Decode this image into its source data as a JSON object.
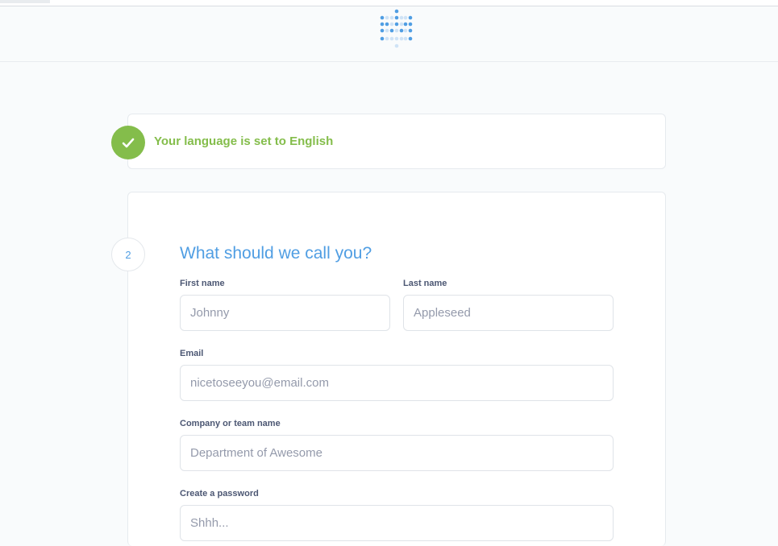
{
  "header": {
    "logo_icon": "metabase-dots-logo-icon"
  },
  "language_step": {
    "icon": "check-icon",
    "status_color": "#84bd4b",
    "message": "Your language is set to English"
  },
  "user_step": {
    "step_number": "2",
    "title": "What should we call you?",
    "accent_color": "#509ee3",
    "fields": {
      "first_name": {
        "label": "First name",
        "placeholder": "Johnny",
        "value": ""
      },
      "last_name": {
        "label": "Last name",
        "placeholder": "Appleseed",
        "value": ""
      },
      "email": {
        "label": "Email",
        "placeholder": "nicetoseeyou@email.com",
        "value": ""
      },
      "company": {
        "label": "Company or team name",
        "placeholder": "Department of Awesome",
        "value": ""
      },
      "password": {
        "label": "Create a password",
        "placeholder": "Shhh...",
        "value": ""
      }
    }
  }
}
